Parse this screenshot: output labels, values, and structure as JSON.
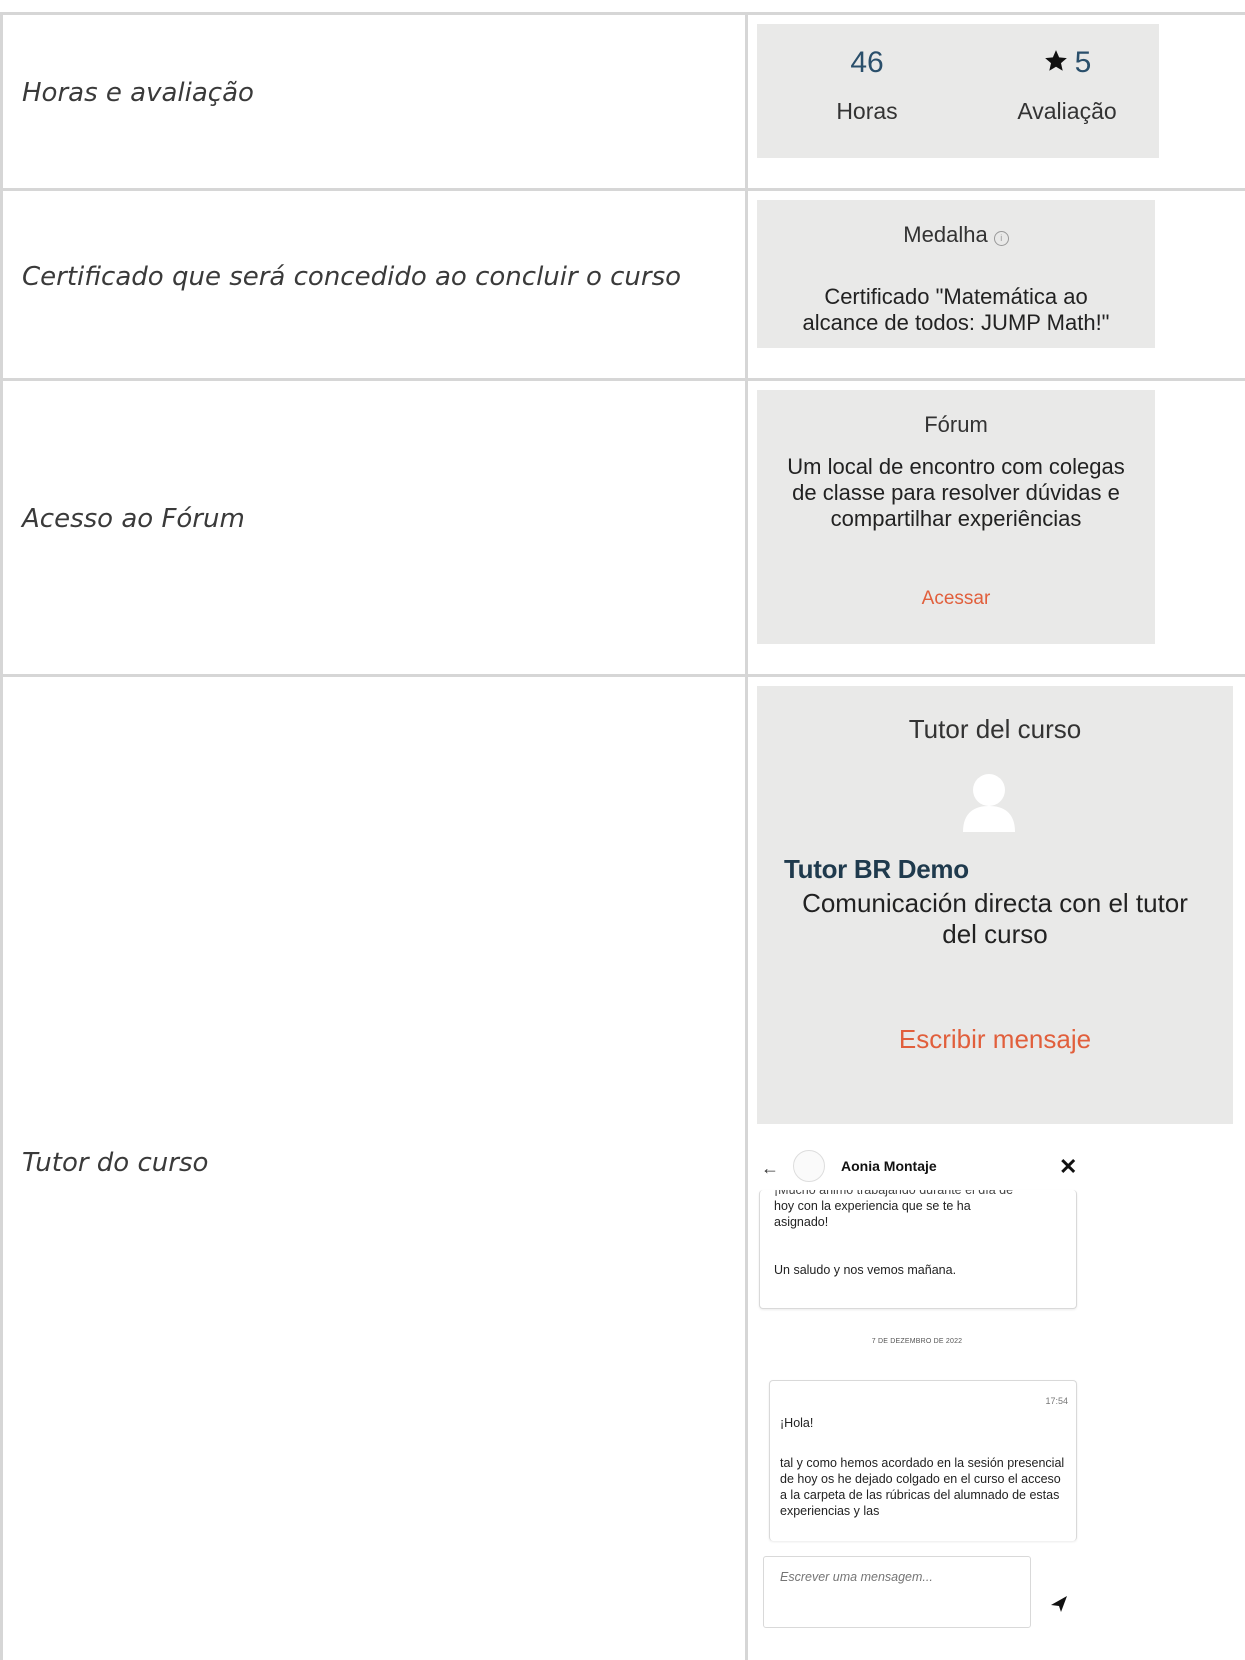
{
  "rows": [
    {
      "label": "Horas e avaliação"
    },
    {
      "label": "Certificado que será concedido ao concluir o curso"
    },
    {
      "label": "Acesso ao Fórum"
    },
    {
      "label": "Tutor do curso"
    }
  ],
  "stats": {
    "hours_value": "46",
    "hours_caption": "Horas",
    "rating_value": "5",
    "rating_caption": "Avaliação"
  },
  "medal": {
    "title": "Medalha",
    "text_line1": "Certificado \"Matemática ao",
    "text_line2": "alcance de todos: JUMP Math!\""
  },
  "forum": {
    "title": "Fórum",
    "description": "Um local de encontro com colegas de classe para resolver dúvidas e compartilhar experiências",
    "link": "Acessar"
  },
  "tutor": {
    "title": "Tutor del curso",
    "name": "Tutor BR Demo",
    "description": "Comunicación directa con el tutor del curso",
    "link": "Escribir mensaje"
  },
  "chat": {
    "contact_name": "Aonia Montaje",
    "msg1_cut": "¡Mucho ánimo trabajando durante el día de",
    "msg1_line2": "hoy con la experiencia que se te ha",
    "msg1_line3": "asignado!",
    "msg1_line4": "Un saludo y nos vemos mañana.",
    "date_separator": "7 DE DEZEMBRO DE 2022",
    "msg2_time": "17:54",
    "msg2_greeting": "¡Hola!",
    "msg2_body": "tal y como hemos acordado en la sesión presencial de hoy os he dejado colgado en el curso el acceso a la carpeta de las rúbricas del alumnado de estas experiencias y las",
    "input_placeholder": "Escrever uma mensagem..."
  },
  "colors": {
    "card_bg": "#e9e9e8",
    "accent_link": "#e15f3c",
    "number_blue": "#2a4f6b",
    "grid_line": "#d6d6d6"
  }
}
